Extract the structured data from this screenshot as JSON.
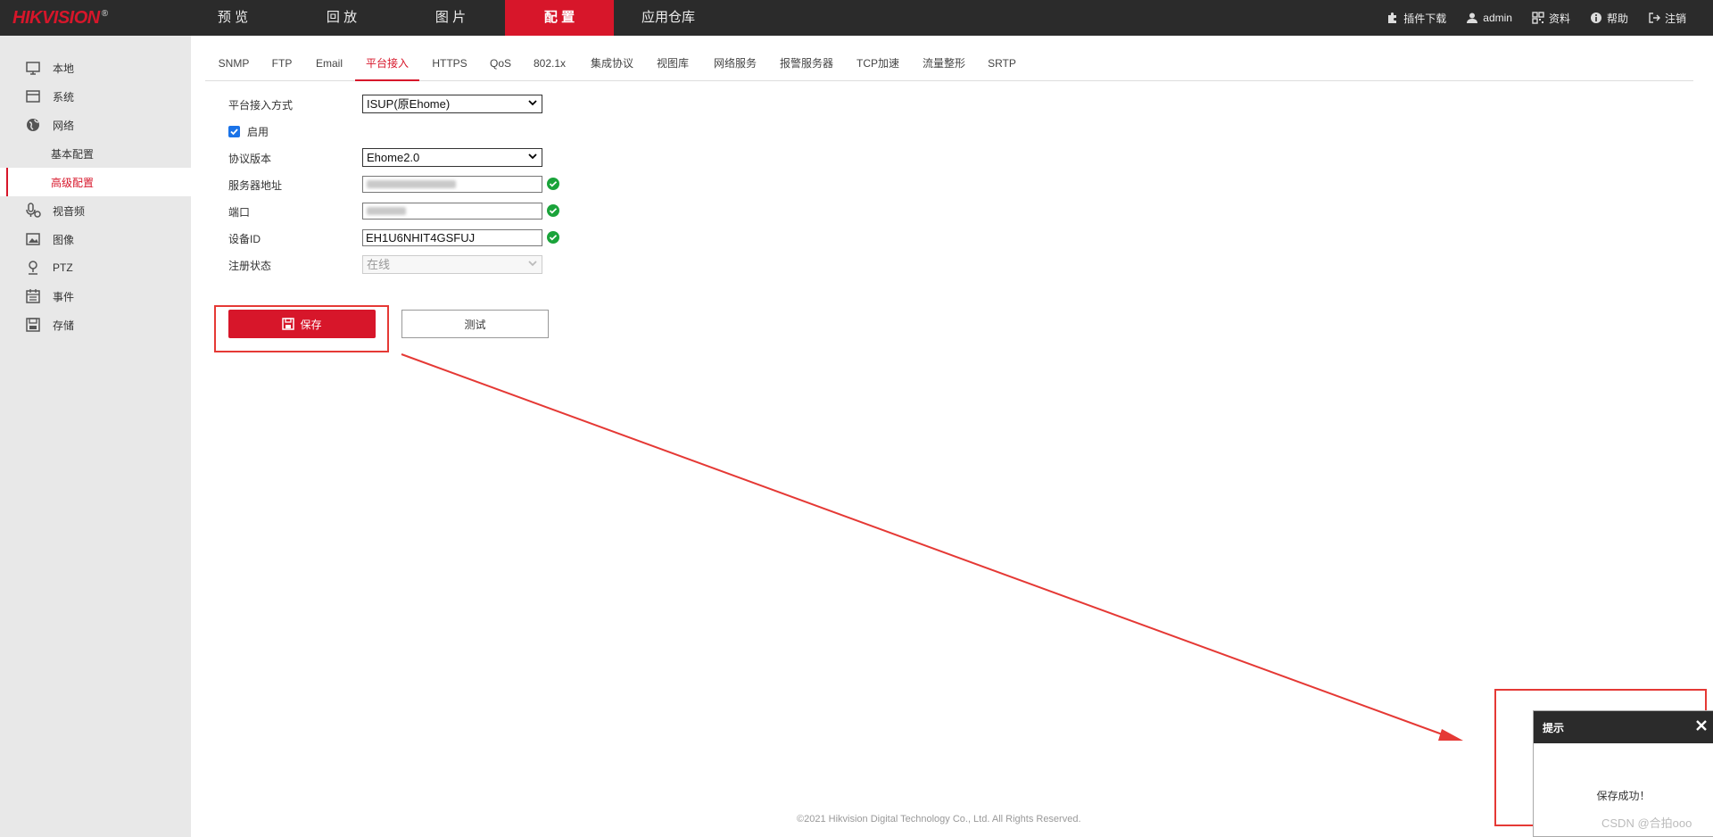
{
  "app": {
    "logo": "HIKVISION",
    "logo_mark": "®"
  },
  "main_nav": [
    {
      "label": "预 览"
    },
    {
      "label": "回 放"
    },
    {
      "label": "图 片"
    },
    {
      "label": "配 置"
    },
    {
      "label": "应用仓库"
    }
  ],
  "top_links": {
    "plugin": "插件下载",
    "user": "admin",
    "docs": "资料",
    "help": "帮助",
    "logout": "注销"
  },
  "sidebar": {
    "items": [
      {
        "label": "本地",
        "icon": "monitor-icon"
      },
      {
        "label": "系统",
        "icon": "window-icon"
      },
      {
        "label": "网络",
        "icon": "globe-icon"
      },
      {
        "label": "视音频",
        "icon": "mic-icon"
      },
      {
        "label": "图像",
        "icon": "image-icon"
      },
      {
        "label": "PTZ",
        "icon": "ptz-icon"
      },
      {
        "label": "事件",
        "icon": "calendar-icon"
      },
      {
        "label": "存储",
        "icon": "disk-icon"
      }
    ],
    "sub_items": [
      {
        "label": "基本配置"
      },
      {
        "label": "高级配置"
      }
    ]
  },
  "tabs": [
    {
      "label": "SNMP"
    },
    {
      "label": "FTP"
    },
    {
      "label": "Email"
    },
    {
      "label": "平台接入"
    },
    {
      "label": "HTTPS"
    },
    {
      "label": "QoS"
    },
    {
      "label": "802.1x"
    },
    {
      "label": "集成协议"
    },
    {
      "label": "视图库"
    },
    {
      "label": "网络服务"
    },
    {
      "label": "报警服务器"
    },
    {
      "label": "TCP加速"
    },
    {
      "label": "流量整形"
    },
    {
      "label": "SRTP"
    }
  ],
  "form": {
    "access_mode_label": "平台接入方式",
    "access_mode_value": "ISUP(原Ehome)",
    "enable_label": "启用",
    "enable_checked": true,
    "protocol_label": "协议版本",
    "protocol_value": "Ehome2.0",
    "server_label": "服务器地址",
    "port_label": "端口",
    "device_id_label": "设备ID",
    "device_id_value": "EH1U6NHIT4GSFUJ",
    "status_label": "注册状态",
    "status_value": "在线"
  },
  "buttons": {
    "save": "保存",
    "test": "测试"
  },
  "dialog": {
    "title": "提示",
    "message": "保存成功！"
  },
  "footer": "©2021 Hikvision Digital Technology Co., Ltd. All Rights Reserved.",
  "watermark": "CSDN @合拍ooo",
  "colors": {
    "brand_red": "#d7162a",
    "topbar": "#2b2b2b",
    "sidebar": "#e8e8e8",
    "annotation": "#e53935",
    "ok_green": "#1aa33a"
  }
}
